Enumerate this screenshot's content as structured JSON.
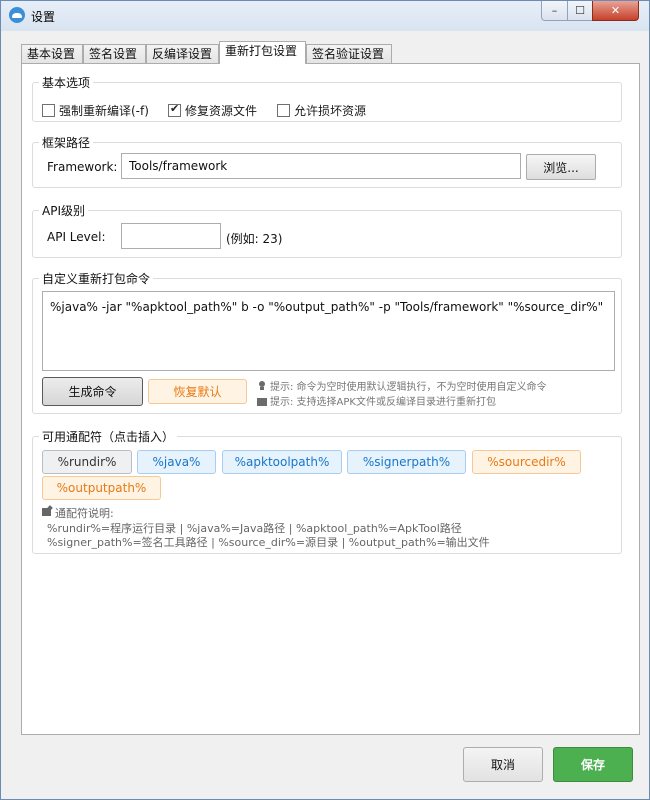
{
  "window": {
    "title": "设置",
    "controls": {
      "minimize": "–",
      "maximize": "☐",
      "close": "✕"
    }
  },
  "tabs": [
    {
      "label": "基本设置",
      "active": false
    },
    {
      "label": "签名设置",
      "active": false
    },
    {
      "label": "反编译设置",
      "active": false
    },
    {
      "label": "重新打包设置",
      "active": true
    },
    {
      "label": "签名验证设置",
      "active": false
    }
  ],
  "basic_options": {
    "title": "基本选项",
    "items": [
      {
        "label": "强制重新编译(-f)",
        "checked": false
      },
      {
        "label": "修复资源文件",
        "checked": true
      },
      {
        "label": "允许损坏资源",
        "checked": false
      }
    ]
  },
  "framework": {
    "title": "框架路径",
    "label": "Framework:",
    "value": "Tools/framework",
    "browse_label": "浏览..."
  },
  "api": {
    "title": "API级别",
    "label": "API Level:",
    "value": "",
    "hint": "(例如: 23)"
  },
  "custom_command": {
    "title": "自定义重新打包命令",
    "command": "%java% -jar \"%apktool_path%\" b -o \"%output_path%\" -p \"Tools/framework\" \"%source_dir%\"",
    "generate_label": "生成命令",
    "reset_label": "恢复默认",
    "hint1": "提示: 命令为空时使用默认逻辑执行，不为空时使用自定义命令",
    "hint2": "提示: 支持选择APK文件或反编译目录进行重新打包"
  },
  "wildcards": {
    "title": "可用通配符（点击插入）",
    "chips": [
      {
        "label": "%rundir%",
        "style": "gray"
      },
      {
        "label": "%java%",
        "style": "blue"
      },
      {
        "label": "%apktoolpath%",
        "style": "blue"
      },
      {
        "label": "%signerpath%",
        "style": "blue"
      },
      {
        "label": "%sourcedir%",
        "style": "orange"
      },
      {
        "label": "%outputpath%",
        "style": "orange"
      }
    ],
    "desc_title": "通配符说明:",
    "desc_line1": "%rundir%=程序运行目录 | %java%=Java路径 | %apktool_path%=ApkTool路径",
    "desc_line2": "%signer_path%=签名工具路径 | %source_dir%=源目录 | %output_path%=输出文件"
  },
  "footer": {
    "cancel_label": "取消",
    "save_label": "保存"
  },
  "colors": {
    "accent_blue": "#1976c9",
    "accent_orange": "#e77a14",
    "save_green": "#4caf50"
  }
}
